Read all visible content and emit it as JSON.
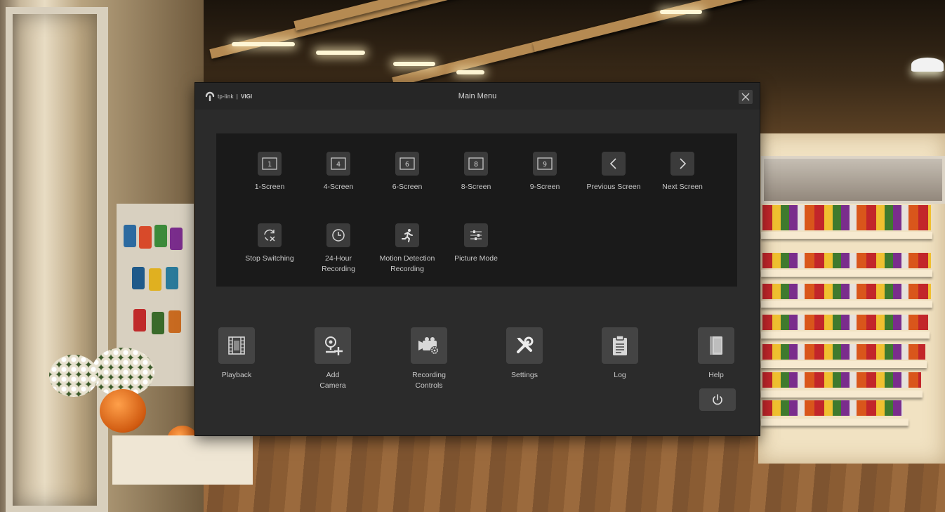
{
  "window": {
    "brand": "tp-link",
    "model": "VIGI",
    "title": "Main Menu",
    "close_icon": "close-icon"
  },
  "screen_layouts": [
    {
      "label": "1-Screen",
      "icon": "layout-1-icon",
      "glyph": "1"
    },
    {
      "label": "4-Screen",
      "icon": "layout-4-icon",
      "glyph": "4"
    },
    {
      "label": "6-Screen",
      "icon": "layout-6-icon",
      "glyph": "6"
    },
    {
      "label": "8-Screen",
      "icon": "layout-8-icon",
      "glyph": "8"
    },
    {
      "label": "9-Screen",
      "icon": "layout-9-icon",
      "glyph": "9"
    },
    {
      "label": "Previous Screen",
      "icon": "chevron-left-icon"
    },
    {
      "label": "Next Screen",
      "icon": "chevron-right-icon"
    }
  ],
  "live_actions": [
    {
      "label": "Stop Switching",
      "icon": "stop-switching-icon"
    },
    {
      "label": "24-Hour\nRecording",
      "icon": "clock-icon"
    },
    {
      "label": "Motion Detection\nRecording",
      "icon": "running-person-icon"
    },
    {
      "label": "Picture Mode",
      "icon": "sliders-icon"
    }
  ],
  "main_functions": [
    {
      "label": "Playback",
      "icon": "film-icon"
    },
    {
      "label": "Add\nCamera",
      "icon": "add-camera-icon"
    },
    {
      "label": "Recording\nControls",
      "icon": "video-camera-gear-icon"
    },
    {
      "label": "Settings",
      "icon": "tools-icon"
    },
    {
      "label": "Log",
      "icon": "clipboard-icon"
    },
    {
      "label": "Help",
      "icon": "book-icon"
    }
  ],
  "power": {
    "icon": "power-icon"
  },
  "colors": {
    "window_bg": "#2b2b2b",
    "panel_bg": "#1a1a1a",
    "icon_bg": "#3b3b3b",
    "text": "#c9c9c9"
  }
}
